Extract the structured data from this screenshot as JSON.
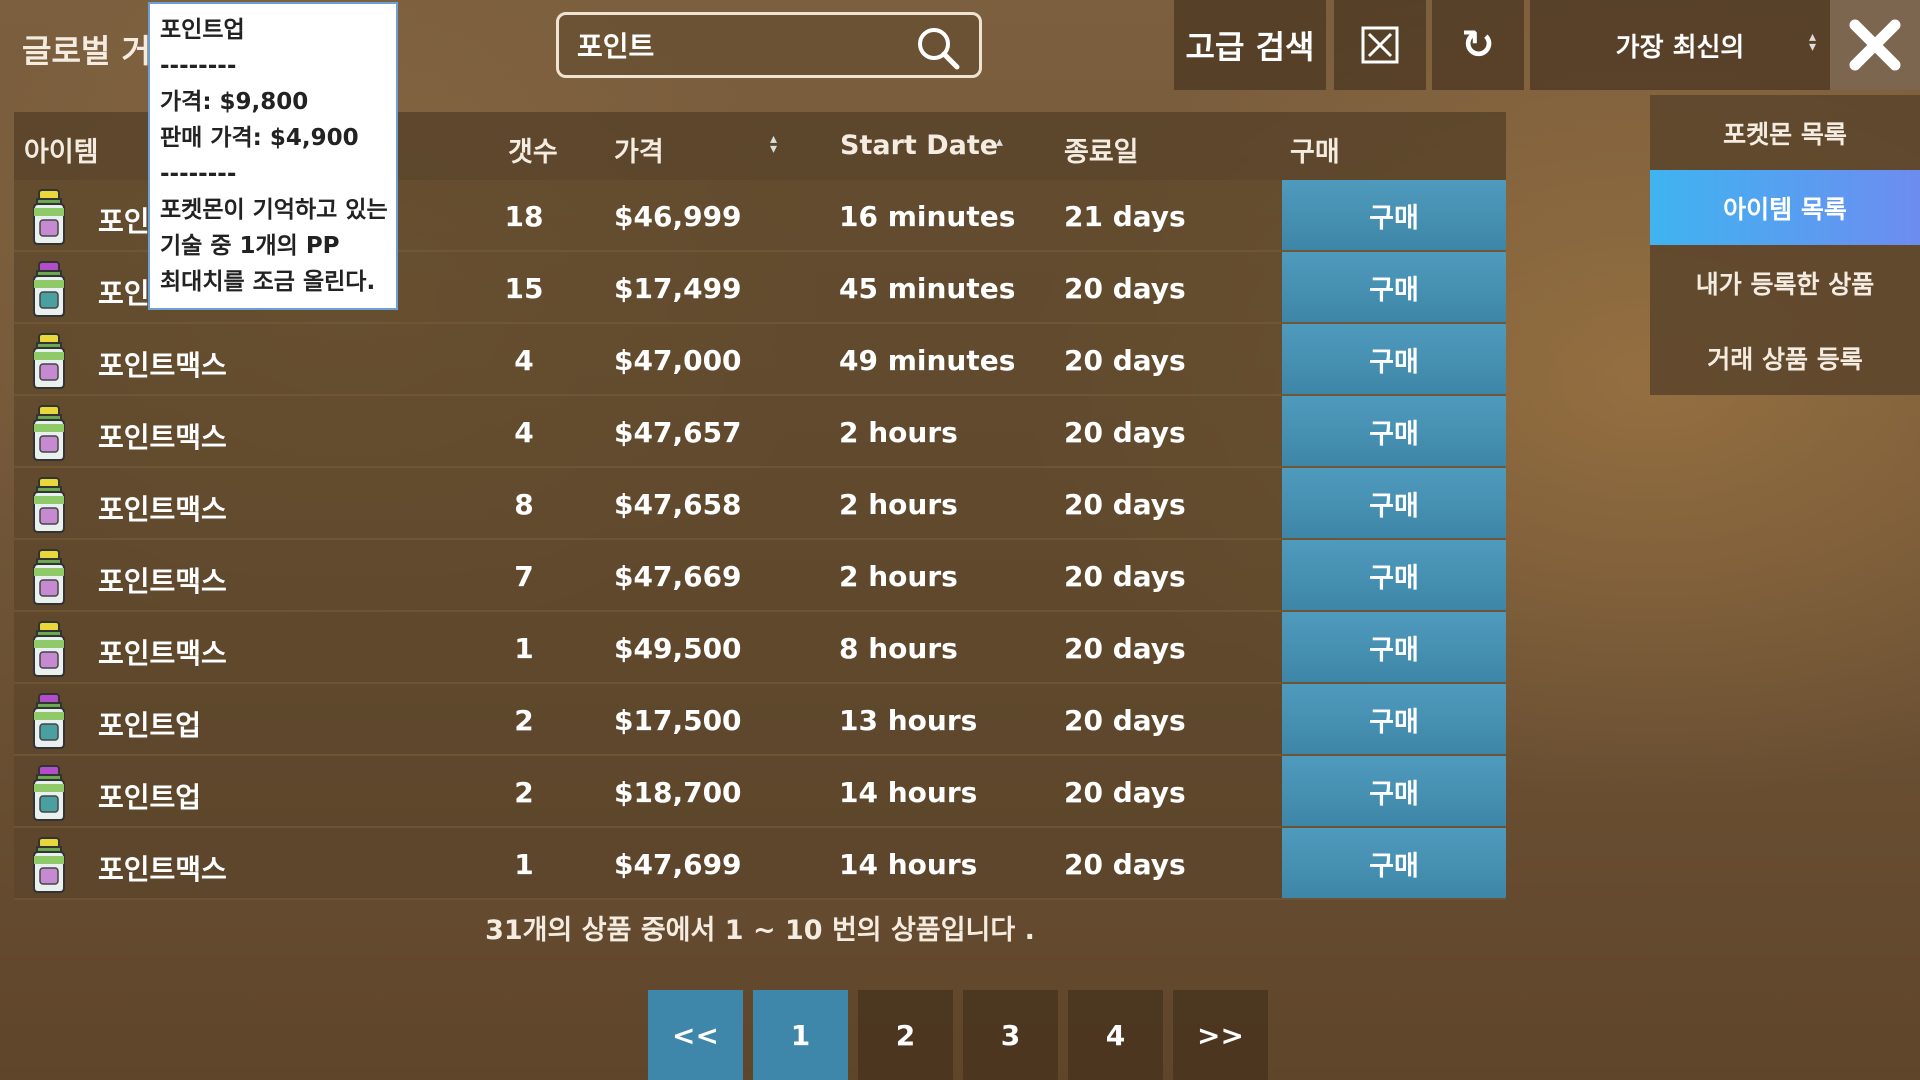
{
  "header": {
    "title": "글로벌 거래소",
    "search_value": "포인트",
    "advanced_search_label": "고급 검색",
    "clear_icon": "x-box-icon",
    "refresh_symbol": "↻",
    "sort_label": "가장 최신의",
    "close_symbol": "✖"
  },
  "side_menu": {
    "items": [
      {
        "label": "포켓몬 목록",
        "active": false
      },
      {
        "label": "아이템 목록",
        "active": true
      },
      {
        "label": "내가 등록한 상품",
        "active": false
      },
      {
        "label": "거래 상품 등록",
        "active": false
      }
    ]
  },
  "table": {
    "columns": {
      "item": "아이템",
      "qty": "갯수",
      "price": "가격",
      "start_date": "Start Date",
      "end_date": "종료일",
      "buy": "구매"
    },
    "rows": [
      {
        "name": "포인트맥스",
        "icon": "pp-max-bottle-icon",
        "qty": "18",
        "price": "$46,999",
        "start": "16 minutes",
        "end": "21 days",
        "buy": "구매"
      },
      {
        "name": "포인트업",
        "icon": "pp-up-bottle-icon",
        "qty": "15",
        "price": "$17,499",
        "start": "45 minutes",
        "end": "20 days",
        "buy": "구매"
      },
      {
        "name": "포인트맥스",
        "icon": "pp-max-bottle-icon",
        "qty": "4",
        "price": "$47,000",
        "start": "49 minutes",
        "end": "20 days",
        "buy": "구매"
      },
      {
        "name": "포인트맥스",
        "icon": "pp-max-bottle-icon",
        "qty": "4",
        "price": "$47,657",
        "start": "2 hours",
        "end": "20 days",
        "buy": "구매"
      },
      {
        "name": "포인트맥스",
        "icon": "pp-max-bottle-icon",
        "qty": "8",
        "price": "$47,658",
        "start": "2 hours",
        "end": "20 days",
        "buy": "구매"
      },
      {
        "name": "포인트맥스",
        "icon": "pp-max-bottle-icon",
        "qty": "7",
        "price": "$47,669",
        "start": "2 hours",
        "end": "20 days",
        "buy": "구매"
      },
      {
        "name": "포인트맥스",
        "icon": "pp-max-bottle-icon",
        "qty": "1",
        "price": "$49,500",
        "start": "8 hours",
        "end": "20 days",
        "buy": "구매"
      },
      {
        "name": "포인트업",
        "icon": "pp-up-bottle-icon",
        "qty": "2",
        "price": "$17,500",
        "start": "13 hours",
        "end": "20 days",
        "buy": "구매"
      },
      {
        "name": "포인트업",
        "icon": "pp-up-bottle-icon",
        "qty": "2",
        "price": "$18,700",
        "start": "14 hours",
        "end": "20 days",
        "buy": "구매"
      },
      {
        "name": "포인트맥스",
        "icon": "pp-max-bottle-icon",
        "qty": "1",
        "price": "$47,699",
        "start": "14 hours",
        "end": "20 days",
        "buy": "구매"
      }
    ]
  },
  "summary": "31개의 상품 중에서 1 ~ 10 번의 상품입니다 .",
  "pagination": {
    "first": "<<",
    "pages": [
      "1",
      "2",
      "3",
      "4"
    ],
    "active_page": "1",
    "last": ">>"
  },
  "tooltip": {
    "lines": [
      "포인트업",
      "--------",
      "가격: $9,800",
      "판매 가격: $4,900",
      "--------",
      "포켓몬이 기억하고 있는",
      "기술 중 1개의 PP",
      "최대치를 조금 올린다."
    ]
  },
  "colors": {
    "buy_button": "#4590b3",
    "active_tab": "#3fb4f0",
    "pp_max_cap": "#e8d83a",
    "pp_up_cap": "#b04fc8"
  }
}
